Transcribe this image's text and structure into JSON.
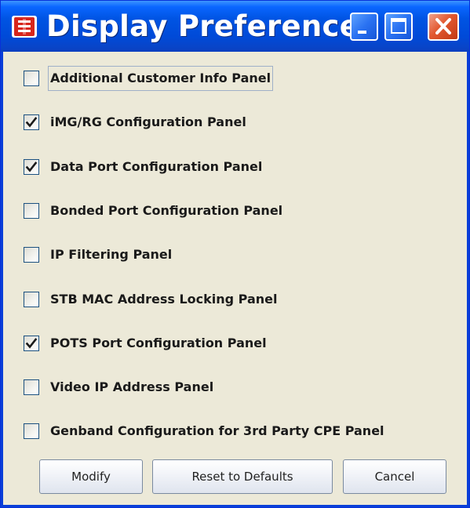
{
  "window": {
    "title": "Display Preferences",
    "icon": "java-app-icon",
    "controls": [
      "minimize-icon",
      "maximize-icon",
      "close-icon"
    ]
  },
  "panels": [
    {
      "label": "Additional Customer Info Panel",
      "checked": false
    },
    {
      "label": "iMG/RG Configuration Panel",
      "checked": true
    },
    {
      "label": "Data Port Configuration Panel",
      "checked": true
    },
    {
      "label": "Bonded Port Configuration Panel",
      "checked": false
    },
    {
      "label": "IP Filtering Panel",
      "checked": false
    },
    {
      "label": "STB MAC Address Locking Panel",
      "checked": false
    },
    {
      "label": "POTS Port Configuration Panel",
      "checked": true
    },
    {
      "label": "Video IP Address Panel",
      "checked": false
    },
    {
      "label": "Genband Configuration for 3rd Party CPE Panel",
      "checked": false
    }
  ],
  "buttons": {
    "modify": "Modify",
    "reset": "Reset to Defaults",
    "cancel": "Cancel"
  }
}
